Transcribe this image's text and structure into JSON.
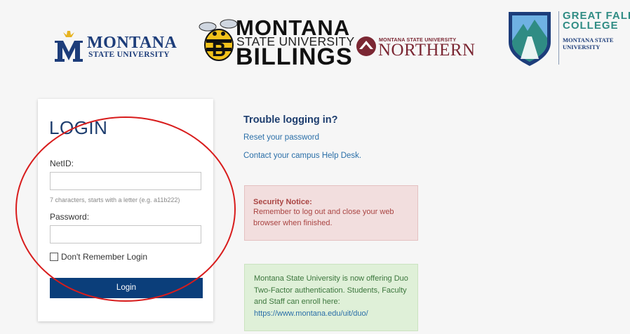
{
  "logos": {
    "msu": {
      "line1": "MONTANA",
      "line2": "STATE UNIVERSITY"
    },
    "billings": {
      "line1": "MONTANA",
      "line2": "STATE UNIVERSITY",
      "line3": "BILLINGS"
    },
    "northern": {
      "line1": "MONTANA STATE UNIVERSITY",
      "line2": "NORTHERN"
    },
    "gfc": {
      "line1": "GREAT FALLS",
      "line2": "COLLEGE",
      "line3": "MONTANA STATE",
      "line4": "UNIVERSITY"
    }
  },
  "login": {
    "title": "LOGIN",
    "netid_label": "NetID:",
    "netid_value": "",
    "netid_hint": "7 characters, starts with a letter (e.g. a11b222)",
    "password_label": "Password:",
    "password_value": "",
    "remember_label": "Don't Remember Login",
    "button_label": "Login"
  },
  "help": {
    "title": "Trouble logging in?",
    "reset_link": "Reset your password",
    "helpdesk_link": "Contact your campus Help Desk."
  },
  "security_notice": {
    "heading": "Security Notice:",
    "body": "Remember to log out and close your web browser when finished."
  },
  "duo_notice": {
    "body": "Montana State University is now offering Duo Two-Factor authentication. Students, Faculty and Staff can enroll here:",
    "link": "https://www.montana.edu/uit/duo/"
  },
  "colors": {
    "brand_navy": "#0b3e7a",
    "heading_blue": "#1d3d6e",
    "link_blue": "#2b6fa8",
    "annotation_red": "#d81c1c",
    "northern_maroon": "#7b2733",
    "gfc_teal": "#2f8c84"
  }
}
